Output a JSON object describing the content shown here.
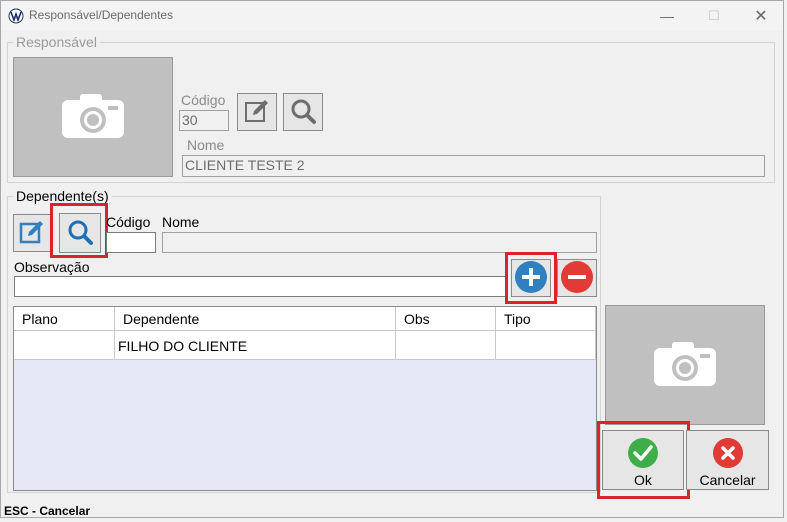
{
  "window": {
    "title": "Responsável/Dependentes",
    "minimize_glyph": "—",
    "maximize_glyph": "☐",
    "close_glyph": "✕"
  },
  "responsavel": {
    "legend": "Responsável",
    "codigo_label": "Código",
    "codigo_value": "30",
    "nome_label": "Nome",
    "nome_value": "CLIENTE TESTE 2"
  },
  "dependentes": {
    "legend": "Dependente(s)",
    "codigo_label": "Código",
    "codigo_value": "",
    "nome_label": "Nome",
    "nome_value": "",
    "observacao_label": "Observação",
    "observacao_value": ""
  },
  "table": {
    "columns": [
      "Plano",
      "Dependente",
      "Obs",
      "Tipo"
    ],
    "rows": [
      {
        "plano": "",
        "dependente": "FILHO DO CLIENTE",
        "obs": "",
        "tipo": ""
      }
    ]
  },
  "buttons": {
    "ok_label": "Ok",
    "cancel_label": "Cancelar"
  },
  "statusbar": {
    "text": "ESC - Cancelar"
  },
  "colors": {
    "highlight": "#d9232d",
    "add": "#2f7fc1",
    "remove": "#e03b34",
    "ok": "#3fae49",
    "cancel": "#e03b34",
    "grid_bg": "#e6e8f8"
  },
  "icons": {
    "photo": "camera-icon",
    "edit": "edit-icon",
    "search": "search-icon",
    "add": "plus-circle-icon",
    "remove": "minus-circle-icon",
    "ok": "check-circle-icon",
    "cancel": "x-circle-icon"
  }
}
